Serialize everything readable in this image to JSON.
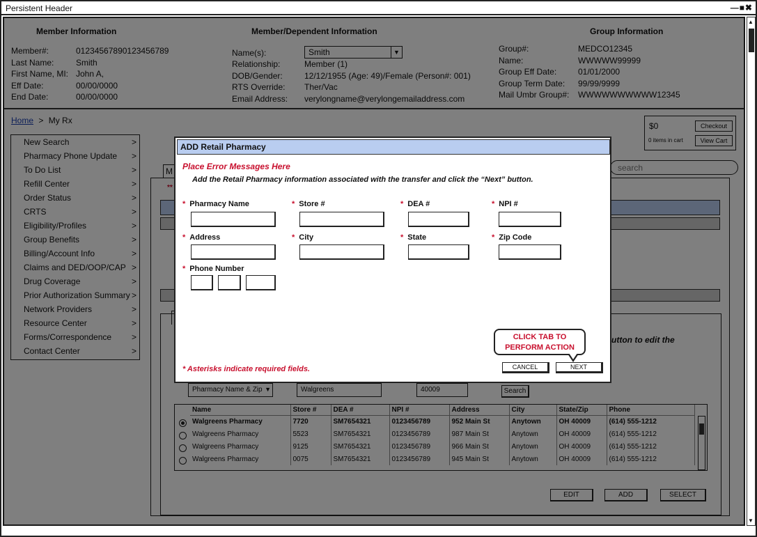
{
  "window": {
    "title": "Persistent Header",
    "controls": "—■✖"
  },
  "member_info": {
    "title": "Member Information",
    "fields": [
      {
        "label": "Member#:",
        "value": "01234567890123456789"
      },
      {
        "label": "Last Name:",
        "value": "Smith"
      },
      {
        "label": "First Name, MI:",
        "value": "John A,"
      },
      {
        "label": "Eff Date:",
        "value": "00/00/0000"
      },
      {
        "label": "End Date:",
        "value": "00/00/0000"
      }
    ]
  },
  "dependent_info": {
    "title": "Member/Dependent Information",
    "name_label": "Name(s):",
    "name_selected": "Smith",
    "fields": [
      {
        "label": "Relationship:",
        "value": "Member (1)"
      },
      {
        "label": "DOB/Gender:",
        "value": "12/12/1955 (Age: 49)/Female (Person#: 001)"
      },
      {
        "label": "RTS Override:",
        "value": "Ther/Vac"
      },
      {
        "label": "Email Address:",
        "value": "verylongname@verylongemailaddress.com"
      }
    ]
  },
  "group_info": {
    "title": "Group Information",
    "fields": [
      {
        "label": "Group#:",
        "value": "MEDCO12345"
      },
      {
        "label": "Name:",
        "value": "WWWWW99999"
      },
      {
        "label": "Group Eff Date:",
        "value": "01/01/2000"
      },
      {
        "label": "Group Term Date:",
        "value": "99/99/9999"
      },
      {
        "label": "Mail Umbr Group#:",
        "value": "WWWWWWWWWW12345"
      }
    ]
  },
  "breadcrumb": {
    "home": "Home",
    "sep": ">",
    "current": "My Rx"
  },
  "leftnav": {
    "chevron": ">",
    "items": [
      "New Search",
      "Pharmacy Phone Update",
      "To Do List",
      "Refill Center",
      "Order Status",
      "CRTS",
      "Eligibility/Profiles",
      "Group Benefits",
      "Billing/Account Info",
      "Claims and DED/OOP/CAP",
      "Drug Coverage",
      "Prior Authorization Summary",
      "Network Providers",
      "Resource Center",
      "Forms/Correspondence",
      "Contact Center"
    ]
  },
  "cart": {
    "amount": "$0",
    "items_text": "0 items in cart",
    "checkout": "Checkout",
    "view_cart": "View Cart"
  },
  "search": {
    "placeholder": "search"
  },
  "background": {
    "tab_label": "M",
    "asterisks": "**",
    "edit_hint": "utton to edit the",
    "search_type": "Pharmacy Name & Zip",
    "search_name": "Walgreens",
    "search_zip": "40009",
    "search_button": "Search",
    "edit_button": "EDIT",
    "add_button": "ADD",
    "select_button": "SELECT"
  },
  "results": {
    "headers": [
      "Name",
      "Store #",
      "DEA #",
      "NPI #",
      "Address",
      "City",
      "State/Zip",
      "Phone"
    ],
    "rows": [
      [
        "Walgreens Pharmacy",
        "7720",
        "SM7654321",
        "0123456789",
        "952 Main St",
        "Anytown",
        "OH 40009",
        "(614) 555-1212"
      ],
      [
        "Walgreens Pharmacy",
        "5523",
        "SM7654321",
        "0123456789",
        "987 Main St",
        "Anytown",
        "OH 40009",
        "(614) 555-1212"
      ],
      [
        "Walgreens Pharmacy",
        "9125",
        "SM7654321",
        "0123456789",
        "966 Main St",
        "Anytown",
        "OH 40009",
        "(614) 555-1212"
      ],
      [
        "Walgreens Pharmacy",
        "0075",
        "SM7654321",
        "0123456789",
        "945 Main St",
        "Anytown",
        "OH 40009",
        "(614) 555-1212"
      ]
    ],
    "selected_row": 0
  },
  "modal": {
    "title": "ADD Retail Pharmacy",
    "error_placeholder": "Place Error Messages Here",
    "instructions": "Add the Retail Pharmacy information associated with the transfer and click the “Next” button.",
    "fields": {
      "pharmacy_name": "Pharmacy Name",
      "store": "Store #",
      "dea": "DEA #",
      "npi": "NPI #",
      "address": "Address",
      "city": "City",
      "state": "State",
      "zip": "Zip Code",
      "phone": "Phone Number"
    },
    "required_marker": "*",
    "required_note": "* Asterisks indicate required fields.",
    "cancel_button": "CANCEL",
    "next_button": "NEXT",
    "callout": "CLICK TAB TO PERFORM ACTION"
  },
  "colors": {
    "title_bar_blue": "#b9cdf0",
    "error_red": "#c8102e",
    "link_blue": "#1a3fb0"
  }
}
